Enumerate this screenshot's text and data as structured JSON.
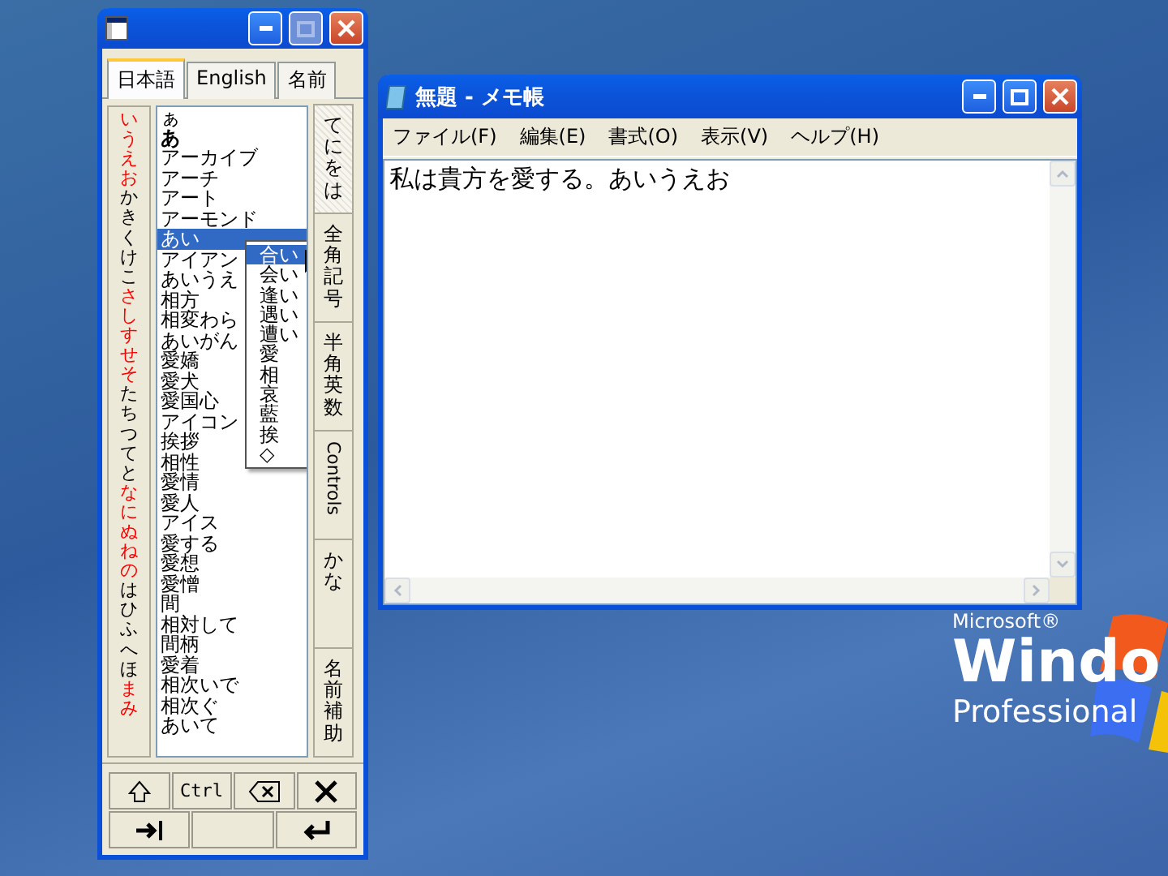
{
  "ime_window": {
    "tabs": [
      {
        "label": "日本語",
        "selected": true
      },
      {
        "label": "English",
        "selected": false
      },
      {
        "label": "名前",
        "selected": false
      }
    ],
    "kana_groups": [
      {
        "text": "いうえお",
        "color": "#ff0000"
      },
      {
        "text": "かきくけこ",
        "color": "#000000"
      },
      {
        "text": "さしすせそ",
        "color": "#ff0000"
      },
      {
        "text": "たちつてと",
        "color": "#000000"
      },
      {
        "text": "なにぬねの",
        "color": "#ff0000"
      },
      {
        "text": "はひふへほ",
        "color": "#000000"
      },
      {
        "text": "まみ",
        "color": "#ff0000"
      }
    ],
    "candidates": [
      {
        "text": "ぁ",
        "bold": false,
        "selected": false
      },
      {
        "text": "あ",
        "bold": true,
        "selected": false
      },
      {
        "text": "アーカイブ",
        "bold": false,
        "selected": false
      },
      {
        "text": "アーチ",
        "bold": false,
        "selected": false
      },
      {
        "text": "アート",
        "bold": false,
        "selected": false
      },
      {
        "text": "アーモンド",
        "bold": false,
        "selected": false
      },
      {
        "text": "あい",
        "bold": false,
        "selected": true
      },
      {
        "text": "アイアン",
        "bold": false,
        "selected": false
      },
      {
        "text": "あいうえ",
        "bold": false,
        "selected": false
      },
      {
        "text": "相方",
        "bold": false,
        "selected": false
      },
      {
        "text": "相変わら",
        "bold": false,
        "selected": false
      },
      {
        "text": "あいがん",
        "bold": false,
        "selected": false
      },
      {
        "text": "愛嬌",
        "bold": false,
        "selected": false
      },
      {
        "text": "愛犬",
        "bold": false,
        "selected": false
      },
      {
        "text": "愛国心",
        "bold": false,
        "selected": false
      },
      {
        "text": "アイコン",
        "bold": false,
        "selected": false
      },
      {
        "text": "挨拶",
        "bold": false,
        "selected": false
      },
      {
        "text": "相性",
        "bold": false,
        "selected": false
      },
      {
        "text": "愛情",
        "bold": false,
        "selected": false
      },
      {
        "text": "愛人",
        "bold": false,
        "selected": false
      },
      {
        "text": "アイス",
        "bold": false,
        "selected": false
      },
      {
        "text": "愛する",
        "bold": false,
        "selected": false
      },
      {
        "text": "愛想",
        "bold": false,
        "selected": false
      },
      {
        "text": "愛憎",
        "bold": false,
        "selected": false
      },
      {
        "text": "間",
        "bold": false,
        "selected": false
      },
      {
        "text": "相対して",
        "bold": false,
        "selected": false
      },
      {
        "text": "間柄",
        "bold": false,
        "selected": false
      },
      {
        "text": "愛着",
        "bold": false,
        "selected": false
      },
      {
        "text": "相次いで",
        "bold": false,
        "selected": false
      },
      {
        "text": "相次ぐ",
        "bold": false,
        "selected": false
      },
      {
        "text": "あいて",
        "bold": false,
        "selected": false
      }
    ],
    "popup": [
      {
        "text": "合い",
        "selected": true
      },
      {
        "text": "会い",
        "selected": false
      },
      {
        "text": "逢い",
        "selected": false
      },
      {
        "text": "遇い",
        "selected": false
      },
      {
        "text": "遭い",
        "selected": false
      },
      {
        "text": "愛",
        "selected": false
      },
      {
        "text": "相",
        "selected": false
      },
      {
        "text": "哀",
        "selected": false
      },
      {
        "text": "藍",
        "selected": false
      },
      {
        "text": "挨",
        "selected": false
      },
      {
        "text": "◇",
        "selected": false
      }
    ],
    "side_tabs": [
      {
        "label": "てにをは",
        "kind": "vertical",
        "selected": true
      },
      {
        "label": "全角記号",
        "kind": "vertical",
        "selected": false
      },
      {
        "label": "半角英数",
        "kind": "vertical",
        "selected": false
      },
      {
        "label": "Controls",
        "kind": "rotated",
        "selected": false
      },
      {
        "label": "かな",
        "kind": "vertical",
        "selected": false
      },
      {
        "label": "名前補助",
        "kind": "vertical",
        "selected": false
      }
    ],
    "keys": [
      [
        {
          "kind": "shift"
        },
        {
          "kind": "text",
          "label": "Ctrl"
        },
        {
          "kind": "backspace"
        },
        {
          "kind": "close"
        }
      ],
      [
        {
          "kind": "tab"
        },
        {
          "kind": "blank"
        },
        {
          "kind": "enter"
        }
      ]
    ]
  },
  "notepad": {
    "title": "無題 - メモ帳",
    "menu": [
      "ファイル(F)",
      "編集(E)",
      "書式(O)",
      "表示(V)",
      "ヘルプ(H)"
    ],
    "text": "私は貴方を愛する。あいうえお"
  },
  "desktop_logo": {
    "maker": "Microsoft®",
    "product": "Windo",
    "edition": "Professional"
  }
}
